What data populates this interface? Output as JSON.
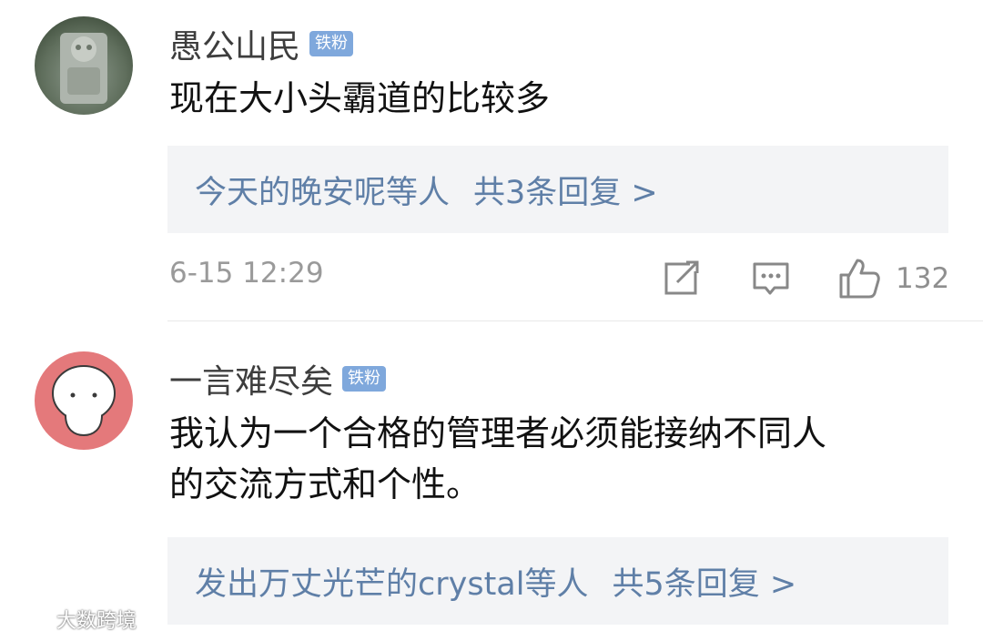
{
  "comments": [
    {
      "username": "愚公山民",
      "badge": "铁粉",
      "text": "现在大小头霸道的比较多",
      "replies_users": "今天的晚安呢等人",
      "replies_count": "共3条回复 >",
      "timestamp": "6-15 12:29",
      "likes": "132"
    },
    {
      "username": "一言难尽矣",
      "badge": "铁粉",
      "text_line1": "我认为一个合格的管理者必须能接纳不同人",
      "text_line2": "的交流方式和个性。",
      "replies_users": "发出万丈光芒的crystal等人",
      "replies_count": "共5条回复 >"
    }
  ],
  "watermark": "大数跨境"
}
